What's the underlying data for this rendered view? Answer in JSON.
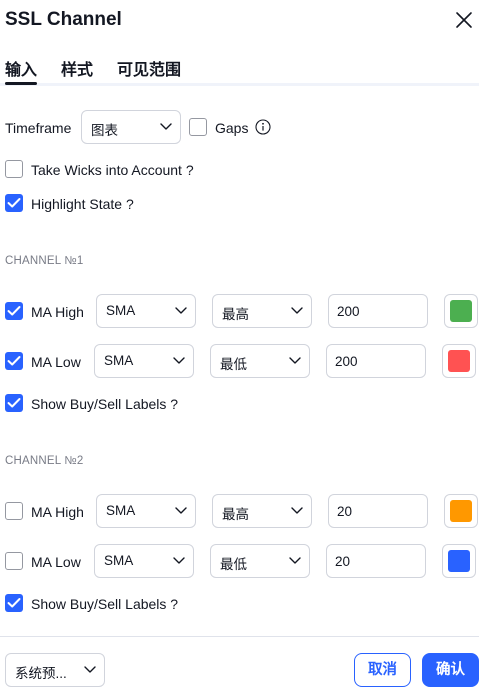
{
  "dialog": {
    "title": "SSL Channel"
  },
  "tabs": [
    {
      "label": "输入",
      "active": true
    },
    {
      "label": "样式",
      "active": false
    },
    {
      "label": "可见范围",
      "active": false
    }
  ],
  "inputs": {
    "timeframe_label": "Timeframe",
    "timeframe_value": "图表",
    "gaps_label": "Gaps",
    "gaps_checked": false,
    "wicks_label": "Take Wicks into Account ?",
    "wicks_checked": false,
    "highlight_label": "Highlight State ?",
    "highlight_checked": true
  },
  "channel1": {
    "title": "CHANNEL №1",
    "ma_high": {
      "label": "MA High",
      "checked": true,
      "type": "SMA",
      "source": "最高",
      "length": "200",
      "color": "#4caf50"
    },
    "ma_low": {
      "label": "MA Low",
      "checked": true,
      "type": "SMA",
      "source": "最低",
      "length": "200",
      "color": "#ff5252"
    },
    "show_labels": {
      "label": "Show Buy/Sell Labels ?",
      "checked": true
    }
  },
  "channel2": {
    "title": "CHANNEL №2",
    "ma_high": {
      "label": "MA High",
      "checked": false,
      "type": "SMA",
      "source": "最高",
      "length": "20",
      "color": "#ff9800"
    },
    "ma_low": {
      "label": "MA Low",
      "checked": false,
      "type": "SMA",
      "source": "最低",
      "length": "20",
      "color": "#2962ff"
    },
    "show_labels": {
      "label": "Show Buy/Sell Labels ?",
      "checked": true
    }
  },
  "footer": {
    "defaults_label": "系统预...",
    "cancel_label": "取消",
    "ok_label": "确认"
  },
  "colors": {
    "accent": "#2962ff",
    "text": "#131722",
    "muted": "#787b86",
    "border": "#d1d4dc"
  }
}
